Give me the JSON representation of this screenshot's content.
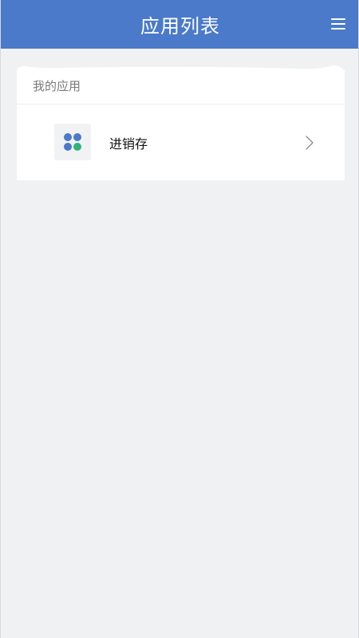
{
  "header": {
    "title": "应用列表",
    "menu_icon": "hamburger-menu-icon",
    "background_color": "#4a7ac9"
  },
  "my_apps": {
    "section_title": "我的应用",
    "items": [
      {
        "name": "进销存",
        "icon": "clover-app-icon",
        "icon_colors": [
          "#4a7ac9",
          "#2fb37a"
        ],
        "trailing_icon": "chevron-right-icon"
      }
    ]
  },
  "page": {
    "background_color": "#f0f1f3"
  }
}
